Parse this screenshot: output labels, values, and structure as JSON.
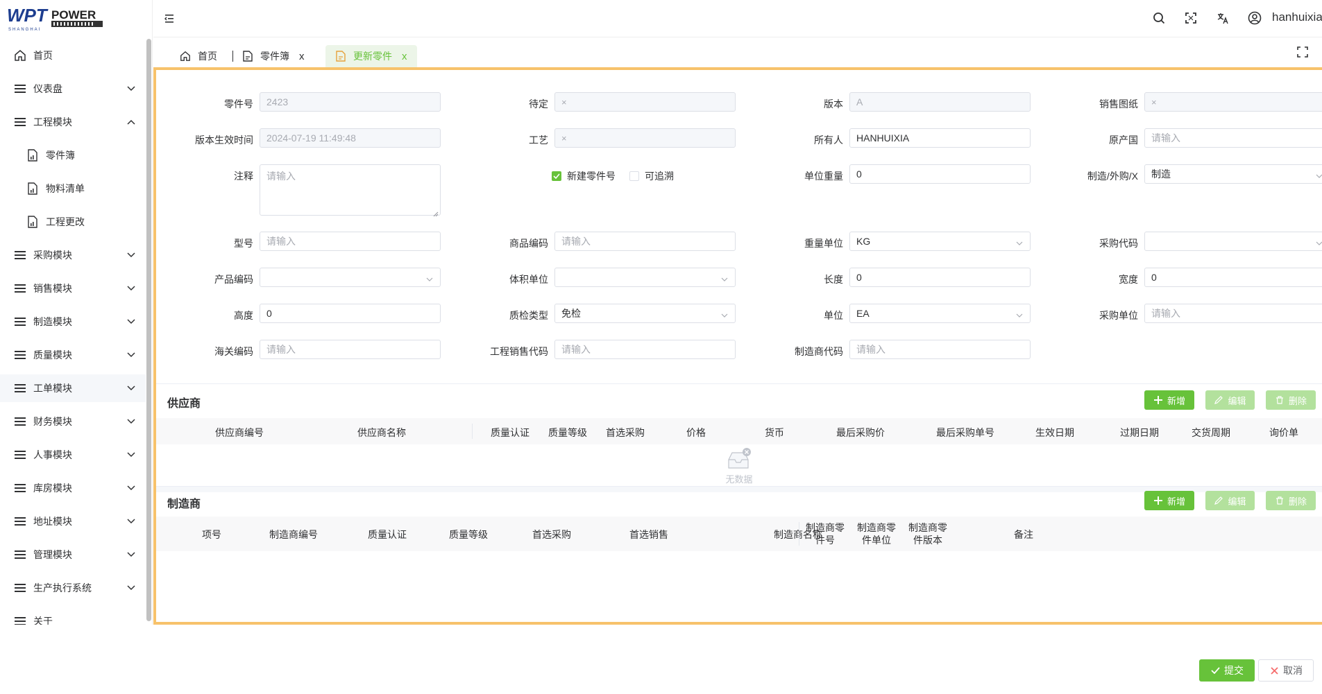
{
  "brand": {
    "logo_text_left": "WPT",
    "logo_text_right": "POWER",
    "logo_sub": "SHANGHAI"
  },
  "sidebar": {
    "items": [
      {
        "label": "首页",
        "icon": "home-icon"
      },
      {
        "label": "仪表盘",
        "icon": "menu-icon"
      },
      {
        "label": "工程模块",
        "icon": "menu-icon"
      },
      {
        "label": "零件簿",
        "icon": "document-chart-icon"
      },
      {
        "label": "物料清单",
        "icon": "document-chart-icon"
      },
      {
        "label": "工程更改",
        "icon": "document-chart-icon"
      },
      {
        "label": "采购模块",
        "icon": "menu-icon"
      },
      {
        "label": "销售模块",
        "icon": "menu-icon"
      },
      {
        "label": "制造模块",
        "icon": "menu-icon"
      },
      {
        "label": "质量模块",
        "icon": "menu-icon"
      },
      {
        "label": "工单模块",
        "icon": "menu-icon"
      },
      {
        "label": "财务模块",
        "icon": "menu-icon"
      },
      {
        "label": "人事模块",
        "icon": "menu-icon"
      },
      {
        "label": "库房模块",
        "icon": "menu-icon"
      },
      {
        "label": "地址模块",
        "icon": "menu-icon"
      },
      {
        "label": "管理模块",
        "icon": "menu-icon"
      },
      {
        "label": "生产执行系统",
        "icon": "menu-icon"
      },
      {
        "label": "关于",
        "icon": "menu-icon"
      }
    ]
  },
  "header": {
    "username": "hanhuixia"
  },
  "tabs": [
    {
      "label": "首页"
    },
    {
      "label": "零件簿",
      "close": "x"
    },
    {
      "label": "更新零件",
      "close": "x"
    }
  ],
  "form": {
    "part_no": {
      "label": "零件号",
      "value": "2423"
    },
    "pending": {
      "label": "待定",
      "value": "×"
    },
    "version": {
      "label": "版本",
      "value": "A"
    },
    "sales_drawing": {
      "label": "销售图纸",
      "value": "×"
    },
    "effective_time": {
      "label": "版本生效时间",
      "value": "2024-07-19 11:49:48"
    },
    "process": {
      "label": "工艺",
      "value": "×"
    },
    "owner": {
      "label": "所有人",
      "value": "HANHUIXIA"
    },
    "origin": {
      "label": "原产国",
      "placeholder": "请输入"
    },
    "remark": {
      "label": "注释",
      "placeholder": "请输入"
    },
    "new_part": {
      "label": "新建零件号",
      "checked": true
    },
    "traceable": {
      "label": "可追溯",
      "checked": false
    },
    "unit_weight": {
      "label": "单位重量",
      "value": "0"
    },
    "make_buy": {
      "label": "制造/外购/X",
      "value": "制造"
    },
    "model": {
      "label": "型号",
      "placeholder": "请输入"
    },
    "product_code": {
      "label": "商品编码",
      "placeholder": "请输入"
    },
    "weight_unit": {
      "label": "重量单位",
      "value": "KG"
    },
    "purchase_code": {
      "label": "采购代码",
      "value": ""
    },
    "prod_code": {
      "label": "产品编码",
      "value": ""
    },
    "volume_unit": {
      "label": "体积单位",
      "value": ""
    },
    "length": {
      "label": "长度",
      "value": "0"
    },
    "width": {
      "label": "宽度",
      "value": "0"
    },
    "height": {
      "label": "高度",
      "value": "0"
    },
    "qc_type": {
      "label": "质检类型",
      "value": "免检"
    },
    "unit": {
      "label": "单位",
      "value": "EA"
    },
    "purchase_unit": {
      "label": "采购单位",
      "placeholder": "请输入"
    },
    "customs_code": {
      "label": "海关编码",
      "placeholder": "请输入"
    },
    "eng_sales_code": {
      "label": "工程销售代码",
      "placeholder": "请输入"
    },
    "mfr_code": {
      "label": "制造商代码",
      "placeholder": "请输入"
    }
  },
  "suppliers": {
    "title": "供应商",
    "buttons": {
      "add": "新增",
      "edit": "编辑",
      "delete": "删除"
    },
    "columns": [
      "供应商编号",
      "供应商名称",
      "质量认证",
      "质量等级",
      "首选采购",
      "价格",
      "货币",
      "最后采购价",
      "最后采购单号",
      "生效日期",
      "过期日期",
      "交货周期",
      "询价单"
    ],
    "empty_text": "无数据"
  },
  "manufacturers": {
    "title": "制造商",
    "buttons": {
      "add": "新增",
      "edit": "编辑",
      "delete": "删除"
    },
    "columns": [
      "项号",
      "制造商编号",
      "质量认证",
      "质量等级",
      "首选采购",
      "首选销售",
      "制造商名称",
      "制造商零件号",
      "制造商零件单位",
      "制造商零件版本",
      "备注"
    ]
  },
  "footer": {
    "submit": "提交",
    "cancel": "取消"
  },
  "colors": {
    "accent": "#67c23a",
    "tab_border": "#f7c26b"
  }
}
